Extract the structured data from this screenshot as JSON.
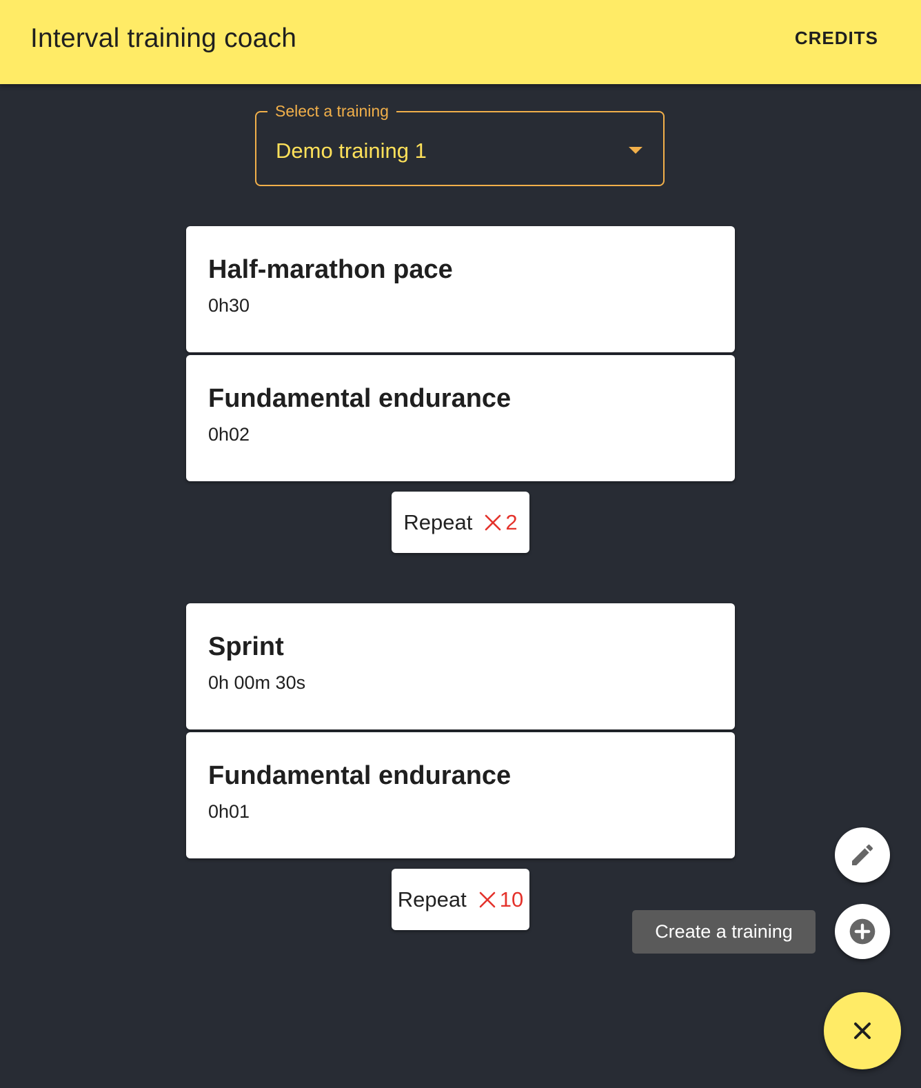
{
  "app": {
    "title": "Interval training coach",
    "credits_label": "CREDITS"
  },
  "select": {
    "label": "Select a training",
    "value": "Demo training 1"
  },
  "blocks": [
    {
      "steps": [
        {
          "name": "Half-marathon pace",
          "duration": "0h30"
        },
        {
          "name": "Fundamental endurance",
          "duration": "0h02"
        }
      ],
      "repeat_label": "Repeat",
      "repeat_count": "2"
    },
    {
      "steps": [
        {
          "name": "Sprint",
          "duration": "0h 00m 30s"
        },
        {
          "name": "Fundamental endurance",
          "duration": "0h01"
        }
      ],
      "repeat_label": "Repeat",
      "repeat_count": "10"
    }
  ],
  "speed_dial": {
    "actions": [
      {
        "icon": "pencil-icon"
      },
      {
        "icon": "add-circle-icon",
        "tooltip": "Create a training"
      }
    ],
    "main_icon": "close-icon"
  },
  "colors": {
    "background": "#282c34",
    "appbar": "#ffeb66",
    "select_outline": "#f2b04a",
    "select_value": "#ffe15a",
    "repeat_accent": "#e4322b",
    "tooltip_bg": "#5a5a5a"
  }
}
